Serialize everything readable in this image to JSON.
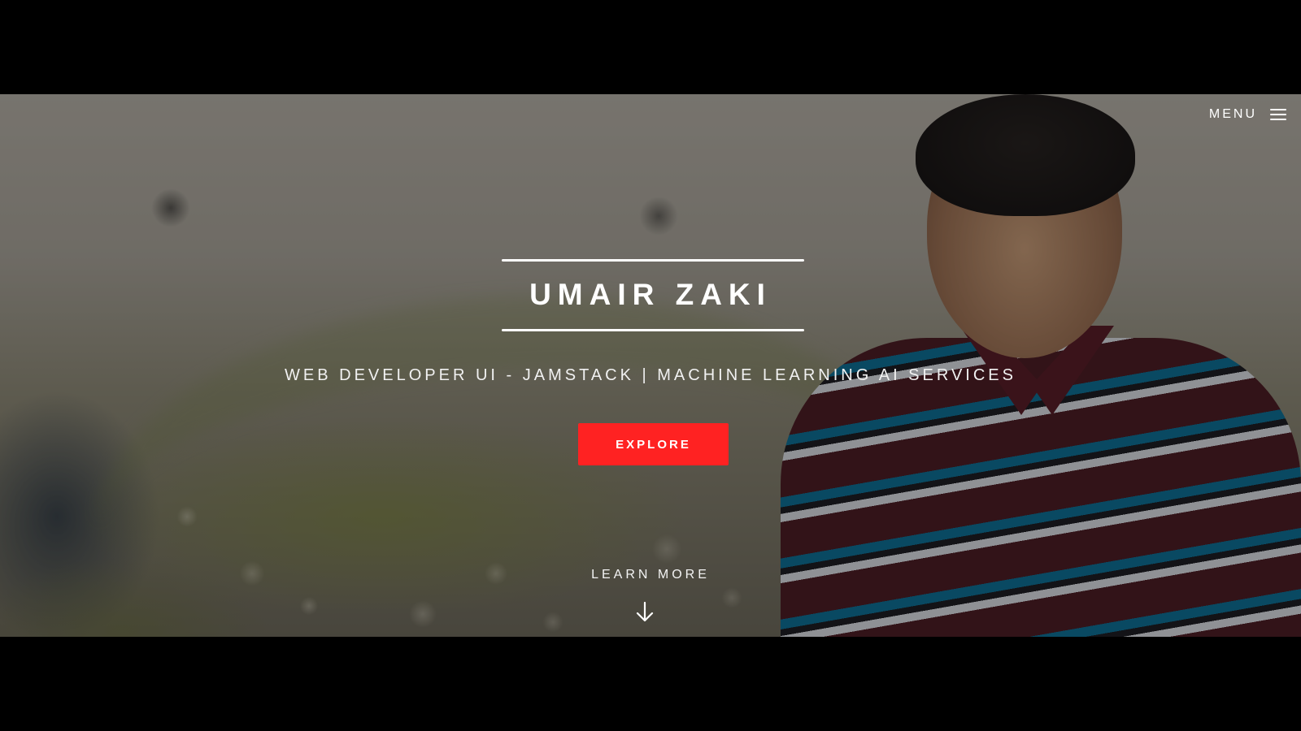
{
  "header": {
    "menu_label": "MENU",
    "menu_icon": "hamburger-menu-icon"
  },
  "hero": {
    "name": "UMAIR ZAKI",
    "tagline": "WEB DEVELOPER UI - JAMSTACK | MACHINE LEARNING AI SERVICES",
    "cta_label": "EXPLORE",
    "learn_more_label": "LEARN MORE",
    "scroll_icon": "arrow-down-icon"
  },
  "colors": {
    "background": "#000000",
    "accent": "#ff2222",
    "text": "#ffffff"
  }
}
